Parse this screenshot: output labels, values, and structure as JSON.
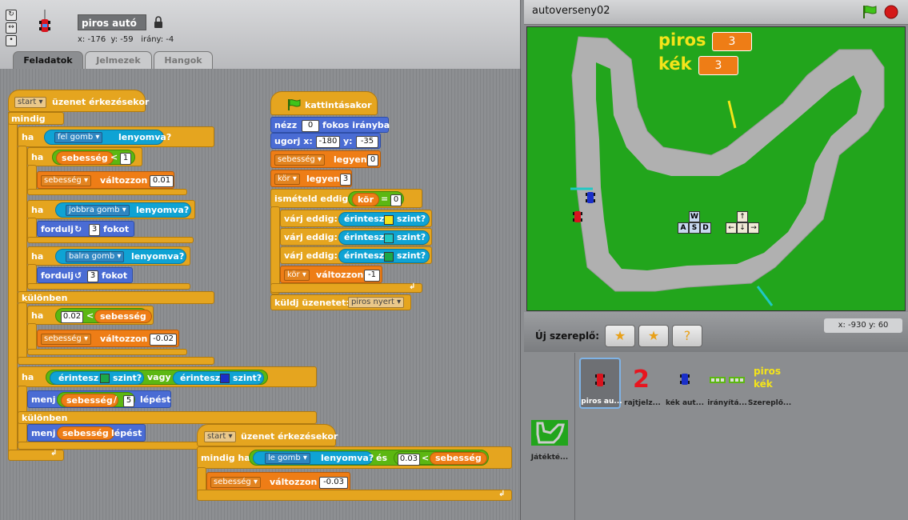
{
  "sprite_header": {
    "name": "piros autó",
    "x_label": "x:",
    "x": "-176",
    "y_label": "y:",
    "y": "-59",
    "dir_label": "irány:",
    "dir": "-4",
    "rot_buttons": [
      "↻",
      "↔",
      "•"
    ],
    "tabs": [
      "Feladatok",
      "Jelmezek",
      "Hangok"
    ]
  },
  "scripts": {
    "s1": {
      "hat_drop": "start",
      "hat_text": "üzenet érkezésekor",
      "forever": "mindig",
      "if": "ha",
      "up_key": "fel gomb",
      "pressed": "lenyomva?",
      "speed": "sebesség",
      "lt": "<",
      "one": "1",
      "change_label": "változzon",
      "change_by": "0.01",
      "right_key": "jobbra gomb",
      "turn": "fordulj",
      "deg3": "3",
      "deg_label": "fokot",
      "left_key": "balra gomb",
      "else": "különben",
      "v002": "0.02",
      "minus002": "-0.02",
      "touch": "érintesz",
      "color_q": "szint?",
      "or": "vagy",
      "move": "menj",
      "div": "/",
      "five": "5",
      "steps": "lépést"
    },
    "s2": {
      "hat_text": "kattintásakor",
      "point": "nézz",
      "dir0": "0",
      "point_tail": "fokos irányba",
      "goto": "ugorj x:",
      "gx": "-180",
      "gy_label": "y:",
      "gy": "-35",
      "set_speed_drop": "sebesség",
      "set_label": "legyen",
      "zero": "0",
      "lap_drop": "kör",
      "three": "3",
      "repeat_until": "ismételd eddig:",
      "lap": "kör",
      "eq": "=",
      "wait_until": "várj eddig:",
      "touch": "érintesz",
      "color_q": "szint?",
      "change_label": "változzon",
      "minus1": "-1",
      "broadcast": "küldj üzenetet:",
      "bmsg": "piros nyert"
    },
    "s3": {
      "hat_drop": "start",
      "hat_text": "üzenet érkezésekor",
      "forever_if": "mindig ha",
      "down_key": "le gomb",
      "pressed": "lenyomva?",
      "and": "és",
      "v003": "0.03",
      "lt": "<",
      "speed": "sebesség",
      "change_label": "változzon",
      "minus003": "-0.03"
    }
  },
  "stage": {
    "title": "autoverseny02",
    "red_label": "piros",
    "red_score": "3",
    "blue_label": "kék",
    "blue_score": "3",
    "wasd_top": "W",
    "wasd_bottom": [
      "A",
      "S",
      "D"
    ],
    "arrows_top": "↑",
    "arrows_bottom": [
      "←",
      "↓",
      "→"
    ],
    "mouse_x_label": "x:",
    "mouse_x": "-930",
    "mouse_y_label": "y:",
    "mouse_y": "60"
  },
  "sprite_panel": {
    "new_sprite": "Új szereplő:",
    "sprites": [
      {
        "caption": "piros au...",
        "selected": true
      },
      {
        "caption": "rajtjelz...",
        "icon_text": "2"
      },
      {
        "caption": "kék aut..."
      },
      {
        "caption": "irányítá..."
      },
      {
        "caption": "Szereplő...",
        "icon_text_1": "piros",
        "icon_text_2": "kék"
      }
    ],
    "stage_caption": "Játékté..."
  },
  "colors": {
    "control": "#e5a51f",
    "motion": "#4a6cd4",
    "variables": "#ee7d16",
    "sensing": "#0fa3d4",
    "operators": "#5cb712",
    "stage_green": "#22a51c",
    "track_gray": "#b0b0b0",
    "swatch_yellow": "#f4e41a",
    "swatch_cyan": "#1fc9c4",
    "swatch_green": "#1ca84a",
    "swatch_blue": "#1a2fc9"
  }
}
